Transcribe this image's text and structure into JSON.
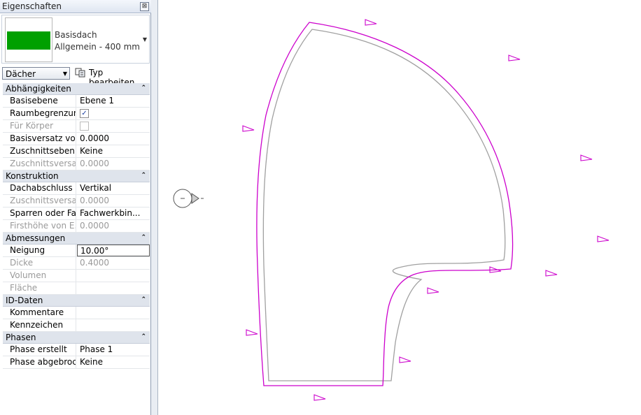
{
  "palette": {
    "title": "Eigenschaften",
    "close_glyph": "⊠",
    "type": {
      "family": "Basisdach",
      "name": "Allgemein - 400 mm",
      "swatch_color": "#00a000"
    },
    "category": "Dächer",
    "edit_type_label": "Typ bearbeiten",
    "groups": [
      {
        "label": "Abhängigkeiten",
        "rows": [
          {
            "name": "Basisebene",
            "value": "Ebene 1",
            "disabled": false
          },
          {
            "name": "Raumbegrenzung",
            "checkbox": true,
            "checked": true,
            "disabled": false
          },
          {
            "name": "Für Körper",
            "checkbox": true,
            "checked": false,
            "disabled": true
          },
          {
            "name": "Basisversatz vo...",
            "value": "0.0000",
            "disabled": false
          },
          {
            "name": "Zuschnittseben...",
            "value": "Keine",
            "disabled": false
          },
          {
            "name": "Zuschnittsversa...",
            "value": "0.0000",
            "disabled": true
          }
        ]
      },
      {
        "label": "Konstruktion",
        "rows": [
          {
            "name": "Dachabschluss ...",
            "value": "Vertikal",
            "disabled": false
          },
          {
            "name": "Zuschnittsversa...",
            "value": "0.0000",
            "disabled": true
          },
          {
            "name": "Sparren oder Fa...",
            "value": "Fachwerkbin...",
            "disabled": false
          },
          {
            "name": "Firsthöhe von E...",
            "value": "0.0000",
            "disabled": true
          }
        ]
      },
      {
        "label": "Abmessungen",
        "rows": [
          {
            "name": "Neigung",
            "value": "10.00°",
            "disabled": false,
            "editing": true
          },
          {
            "name": "Dicke",
            "value": "0.4000",
            "disabled": true
          },
          {
            "name": "Volumen",
            "value": "",
            "disabled": true
          },
          {
            "name": "Fläche",
            "value": "",
            "disabled": true
          }
        ]
      },
      {
        "label": "ID-Daten",
        "rows": [
          {
            "name": "Kommentare",
            "value": "",
            "disabled": false
          },
          {
            "name": "Kennzeichen",
            "value": "",
            "disabled": false
          }
        ]
      },
      {
        "label": "Phasen",
        "rows": [
          {
            "name": "Phase erstellt",
            "value": "Phase 1",
            "disabled": false
          },
          {
            "name": "Phase abgebroc...",
            "value": "Keine",
            "disabled": false
          }
        ]
      }
    ]
  },
  "canvas": {
    "boundary_color": "#cc00cc",
    "roof_edge_color": "#a0a0a0",
    "section_mark_color": "#555555"
  }
}
